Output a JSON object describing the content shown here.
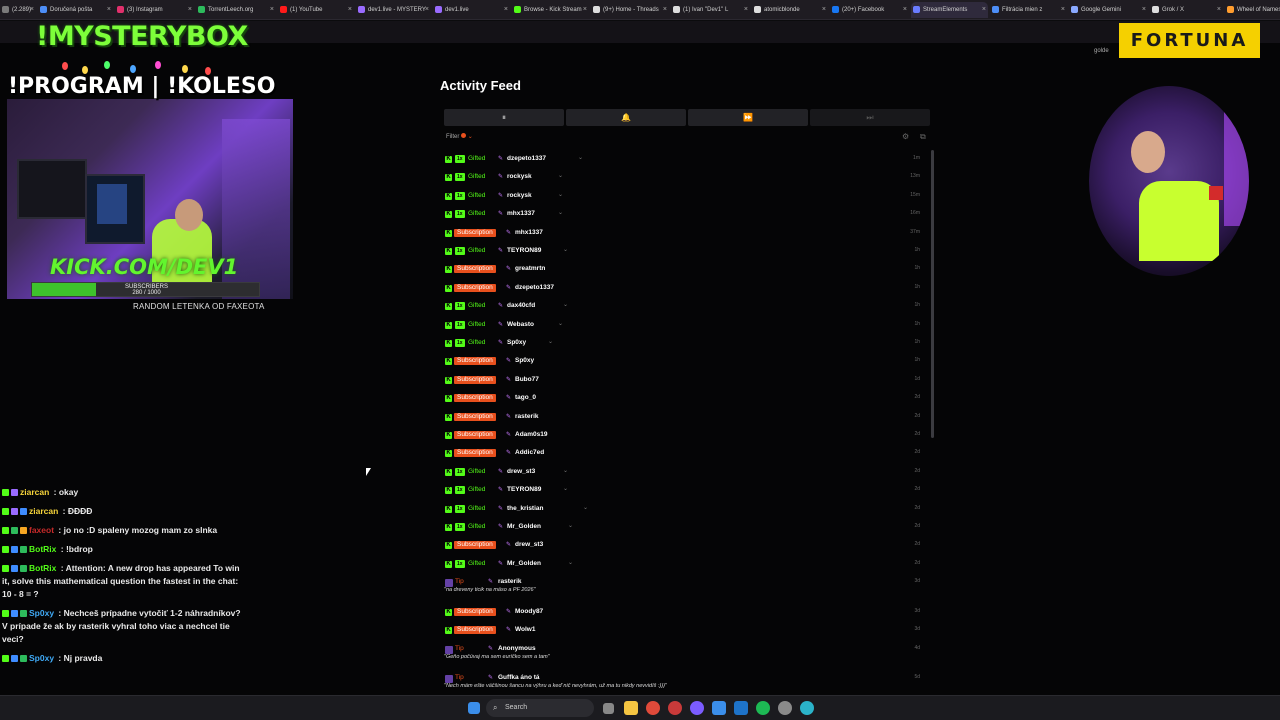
{
  "browser": {
    "tabs": [
      {
        "label": "(2.289)",
        "color": "#7a7a7a"
      },
      {
        "label": "Doručená pošta",
        "color": "#4d8ef7"
      },
      {
        "label": "(3) Instagram",
        "color": "#e1306c"
      },
      {
        "label": "TorrentLeech.org",
        "color": "#2dbb5c"
      },
      {
        "label": "(1) YouTube",
        "color": "#ff1a1a"
      },
      {
        "label": "dev1.live - MYSTERY",
        "color": "#9a6bff"
      },
      {
        "label": "dev1.live",
        "color": "#9a6bff"
      },
      {
        "label": "Browse - Kick Stream",
        "color": "#53fc18"
      },
      {
        "label": "(9+) Home - Threads",
        "color": "#dddddd"
      },
      {
        "label": "(1) Ivan \"Dev1\" L",
        "color": "#dddddd"
      },
      {
        "label": "atomicblonde",
        "color": "#dddddd"
      },
      {
        "label": "(20+) Facebook",
        "color": "#1877f2"
      },
      {
        "label": "StreamElements",
        "color": "#6a7cff"
      },
      {
        "label": "Filtrácia mien z",
        "color": "#4d8ef7"
      },
      {
        "label": "Google Gemini",
        "color": "#8aa9ff"
      },
      {
        "label": "Grok / X",
        "color": "#dddddd"
      },
      {
        "label": "Wheel of Names",
        "color": "#ff9d2e"
      }
    ]
  },
  "overlay": {
    "title1": "!MYSTERYBOX",
    "title2": "!PROGRAM | !KOLESO",
    "kick": "KICK.COM/DEV1",
    "subscribers_label": "SUBSCRIBERS",
    "subscribers_count": "280 / 1000",
    "subscribers_progress": 0.28,
    "random": "RANDOM LETENKA OD FAXEOTA",
    "sponsor": "FORTUNA",
    "sponsor_note": "golde"
  },
  "chat": [
    {
      "user": "ziarcan",
      "text": " : okay",
      "user_color": "#f7d53b",
      "badges": [
        "#53fc18",
        "#9a6bff"
      ]
    },
    {
      "user": "ziarcan",
      "text": " : ĐĐĐĐ",
      "user_color": "#f7d53b",
      "badges": [
        "#53fc18",
        "#9a6bff",
        "#3f8cff"
      ]
    },
    {
      "user": "faxeot",
      "text": " : jo no :D spaleny mozog mam zo slnka",
      "user_color": "#c62a2a",
      "badges": [
        "#53fc18",
        "#2dbb5c",
        "#f5a623"
      ]
    },
    {
      "user": "BotRix",
      "text": " : !bdrop",
      "user_color": "#53fc18",
      "badges": [
        "#53fc18",
        "#3f8cff",
        "#2dbb5c"
      ]
    },
    {
      "user": "BotRix",
      "text": " :       Attention: A new drop has appeared        To win it, solve this mathematical question the fastest in the chat: 10 - 8 = ?",
      "user_color": "#53fc18",
      "badges": [
        "#53fc18",
        "#3f8cff",
        "#2dbb5c"
      ]
    },
    {
      "user": "Sp0xy",
      "text": " : Nechceš prípadne vytočiť 1-2 náhradníkov? V prípade že ak by rasterik vyhral toho viac a nechcel tie veci?",
      "user_color": "#3fa9f5",
      "badges": [
        "#53fc18",
        "#3f8cff",
        "#2dbb5c"
      ]
    },
    {
      "user": "Sp0xy",
      "text": " : Nj pravda",
      "user_color": "#3fa9f5",
      "badges": [
        "#53fc18",
        "#3f8cff",
        "#2dbb5c"
      ]
    }
  ],
  "feed": {
    "title": "Activity Feed",
    "controls": [
      "⏸",
      "🔔",
      "⏩",
      "⏭"
    ],
    "filter_label": "Filter",
    "rows": [
      {
        "type": "gifted",
        "qty": "1x",
        "label": "Gifted",
        "name": "dzepeto1337",
        "time": "1m"
      },
      {
        "type": "gifted",
        "qty": "1x",
        "label": "Gifted",
        "name": "rockysk",
        "time": "13m"
      },
      {
        "type": "gifted",
        "qty": "1x",
        "label": "Gifted",
        "name": "rockysk",
        "time": "15m"
      },
      {
        "type": "gifted",
        "qty": "1x",
        "label": "Gifted",
        "name": "mhx1337",
        "time": "16m"
      },
      {
        "type": "sub",
        "label": "Subscription",
        "name": "mhx1337",
        "time": "37m"
      },
      {
        "type": "gifted",
        "qty": "1x",
        "label": "Gifted",
        "name": "TEYRON89",
        "time": "1h"
      },
      {
        "type": "sub",
        "label": "Subscription",
        "name": "greatmrtn",
        "time": "1h"
      },
      {
        "type": "sub",
        "label": "Subscription",
        "name": "dzepeto1337",
        "time": "1h"
      },
      {
        "type": "gifted",
        "qty": "1x",
        "label": "Gifted",
        "name": "dax40cfd",
        "time": "1h"
      },
      {
        "type": "gifted",
        "qty": "1x",
        "label": "Gifted",
        "name": "Webasto",
        "time": "1h"
      },
      {
        "type": "gifted",
        "qty": "1x",
        "label": "Gifted",
        "name": "Sp0xy",
        "time": "1h"
      },
      {
        "type": "sub",
        "label": "Subscription",
        "name": "Sp0xy",
        "time": "1h"
      },
      {
        "type": "sub",
        "label": "Subscription",
        "name": "Bubo77",
        "time": "1d"
      },
      {
        "type": "sub",
        "label": "Subscription",
        "name": "tago_0",
        "time": "2d"
      },
      {
        "type": "sub",
        "label": "Subscription",
        "name": "rasterik",
        "time": "2d"
      },
      {
        "type": "sub",
        "label": "Subscription",
        "name": "Adam0s19",
        "time": "2d"
      },
      {
        "type": "sub",
        "label": "Subscription",
        "name": "Addic7ed",
        "time": "2d"
      },
      {
        "type": "gifted",
        "qty": "1x",
        "label": "Gifted",
        "name": "drew_st3",
        "time": "2d"
      },
      {
        "type": "gifted",
        "qty": "1x",
        "label": "Gifted",
        "name": "TEYRON89",
        "time": "2d"
      },
      {
        "type": "gifted",
        "qty": "1x",
        "label": "Gifted",
        "name": "the_kristian",
        "time": "2d"
      },
      {
        "type": "gifted",
        "qty": "1x",
        "label": "Gifted",
        "name": "Mr_Golden",
        "time": "2d"
      },
      {
        "type": "sub",
        "label": "Subscription",
        "name": "drew_st3",
        "time": "2d"
      },
      {
        "type": "gifted",
        "qty": "1x",
        "label": "Gifted",
        "name": "Mr_Golden",
        "time": "2d"
      },
      {
        "type": "tip",
        "label": "Tip",
        "name": "rasterik",
        "time": "3d",
        "quote": "\"na dreveny ticik na mäso a PF 2026\""
      },
      {
        "type": "sub",
        "label": "Subscription",
        "name": "Moody87",
        "time": "3d"
      },
      {
        "type": "sub",
        "label": "Subscription",
        "name": "Wolw1",
        "time": "3d"
      },
      {
        "type": "tip",
        "label": "Tip",
        "name": "Anonymous",
        "time": "4d",
        "quote": "\"Geňo počúvaj ma sem euríčko sem a tam\""
      },
      {
        "type": "tip",
        "label": "Tip",
        "name": "Guffka áno tá",
        "time": "5d",
        "quote": "\"Nech mám ešte väčšinou šancu na výhru a keď nič nevyhrám, už ma tu nikdy nevvidíš :)))\""
      }
    ]
  },
  "taskbar": {
    "search_placeholder": "Search"
  }
}
